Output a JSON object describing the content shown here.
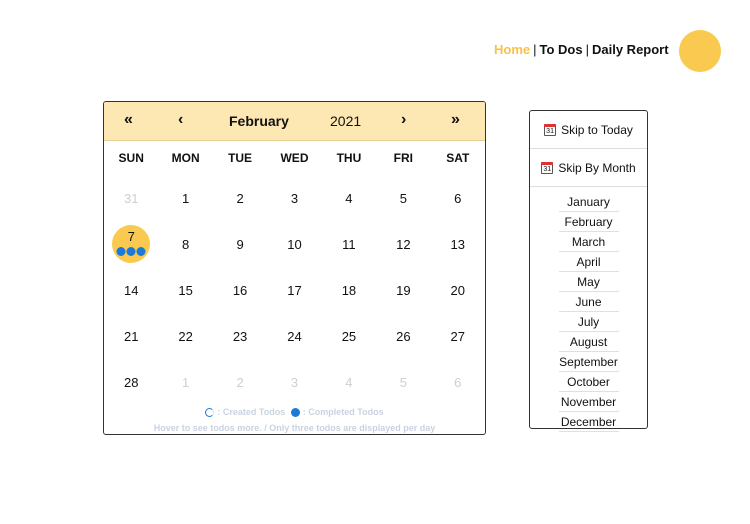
{
  "nav": {
    "home": "Home",
    "todos": "To Dos",
    "report": "Daily Report",
    "sep1": "|",
    "sep2": "|"
  },
  "calendar": {
    "prev_year": "«",
    "prev_month": "‹",
    "next_month": "›",
    "next_year": "»",
    "month": "February",
    "year": "2021",
    "weekdays": [
      "SUN",
      "MON",
      "TUE",
      "WED",
      "THU",
      "FRI",
      "SAT"
    ],
    "days": [
      {
        "d": "31",
        "muted": true
      },
      {
        "d": "1"
      },
      {
        "d": "2"
      },
      {
        "d": "3"
      },
      {
        "d": "4"
      },
      {
        "d": "5"
      },
      {
        "d": "6"
      },
      {
        "d": "7",
        "today": true,
        "completed": 3
      },
      {
        "d": "8"
      },
      {
        "d": "9"
      },
      {
        "d": "10"
      },
      {
        "d": "11"
      },
      {
        "d": "12"
      },
      {
        "d": "13"
      },
      {
        "d": "14"
      },
      {
        "d": "15"
      },
      {
        "d": "16"
      },
      {
        "d": "17"
      },
      {
        "d": "18"
      },
      {
        "d": "19"
      },
      {
        "d": "20"
      },
      {
        "d": "21"
      },
      {
        "d": "22"
      },
      {
        "d": "23"
      },
      {
        "d": "24"
      },
      {
        "d": "25"
      },
      {
        "d": "26"
      },
      {
        "d": "27"
      },
      {
        "d": "28"
      },
      {
        "d": "1",
        "muted": true
      },
      {
        "d": "2",
        "muted": true
      },
      {
        "d": "3",
        "muted": true
      },
      {
        "d": "4",
        "muted": true
      },
      {
        "d": "5",
        "muted": true
      },
      {
        "d": "6",
        "muted": true
      }
    ],
    "legend_created": ": Created Todos",
    "legend_completed": ": Completed Todos",
    "hint": "Hover to see todos more. / Only three todos are displayed per day"
  },
  "side": {
    "icon_day": "31",
    "skip_today": "Skip to Today",
    "skip_month": "Skip By Month",
    "months": [
      "January",
      "February",
      "March",
      "April",
      "May",
      "June",
      "July",
      "August",
      "September",
      "October",
      "November",
      "December"
    ]
  },
  "colors": {
    "accent": "#f9c950",
    "header_bg": "#fde7b2",
    "dot": "#1b7ad8",
    "muted": "#cfcfcf"
  }
}
